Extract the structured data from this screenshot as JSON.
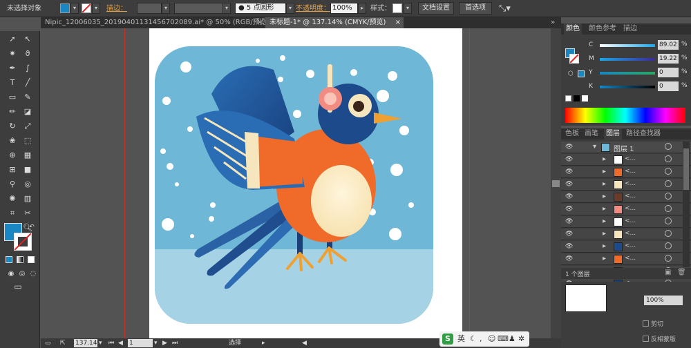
{
  "control_bar": {
    "selection_label": "未选择对象",
    "stroke_label": "描边：",
    "brush_label": "5 点圆形",
    "opacity_label": "不透明度：",
    "opacity_value": "100%",
    "style_label": "样式：",
    "doc_setup_button": "文档设置",
    "prefs_button": "首选项",
    "fill_color": "#1a86c2"
  },
  "tabs": [
    {
      "label": "Nipic_12006035_20190401131456702089.ai* @ 50% (RGB/预览)",
      "close": "×"
    },
    {
      "label": "未标题-1* @ 137.14% (CMYK/预览)",
      "close": "×"
    }
  ],
  "status": {
    "zoom": "137.14",
    "artboard": "1",
    "tool_label": "选择"
  },
  "color_panel": {
    "tabs": [
      "颜色",
      "颜色参考",
      "描边"
    ],
    "channels": [
      {
        "label": "C",
        "value": "89.02",
        "unit": "%"
      },
      {
        "label": "M",
        "value": "19.22",
        "unit": "%"
      },
      {
        "label": "Y",
        "value": "0",
        "unit": "%"
      },
      {
        "label": "K",
        "value": "0",
        "unit": "%"
      }
    ]
  },
  "layers_panel": {
    "tabs": [
      "色板",
      "画笔",
      "图层",
      "路径查找器"
    ],
    "layer_name": "图层 1",
    "sublayer_label": "<...",
    "footer": "1 个图层"
  },
  "bottom_panel": {
    "opacity_value": "100%",
    "clip_label": "剪切",
    "invert_label": "反相蒙版"
  },
  "ime": {
    "lang": "英"
  }
}
